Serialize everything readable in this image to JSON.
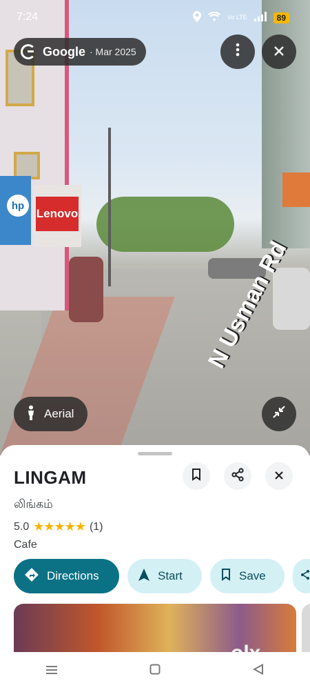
{
  "status": {
    "time": "7:24",
    "battery": "89",
    "network": "Vo LTE"
  },
  "streetview": {
    "brand": "Google",
    "date": "· Mar 2025",
    "aerial_label": "Aerial",
    "road_text": "N Usman Rd",
    "sign_hp": "hp",
    "sign_lenovo": "Lenovo",
    "icons": {
      "more": "more-vert-icon",
      "close": "close-icon",
      "collapse": "collapse-icon",
      "person": "person-icon"
    }
  },
  "place": {
    "title": "LINGAM",
    "native_name": "லிங்கம்",
    "rating": "5.0",
    "stars": "★★★★★",
    "review_count": "(1)",
    "category": "Cafe"
  },
  "actions": {
    "directions": "Directions",
    "start": "Start",
    "save": "Save"
  },
  "watermark": "olx",
  "colors": {
    "primary": "#0b7285",
    "secondary": "#d3f0f5",
    "star": "#f6b400"
  }
}
